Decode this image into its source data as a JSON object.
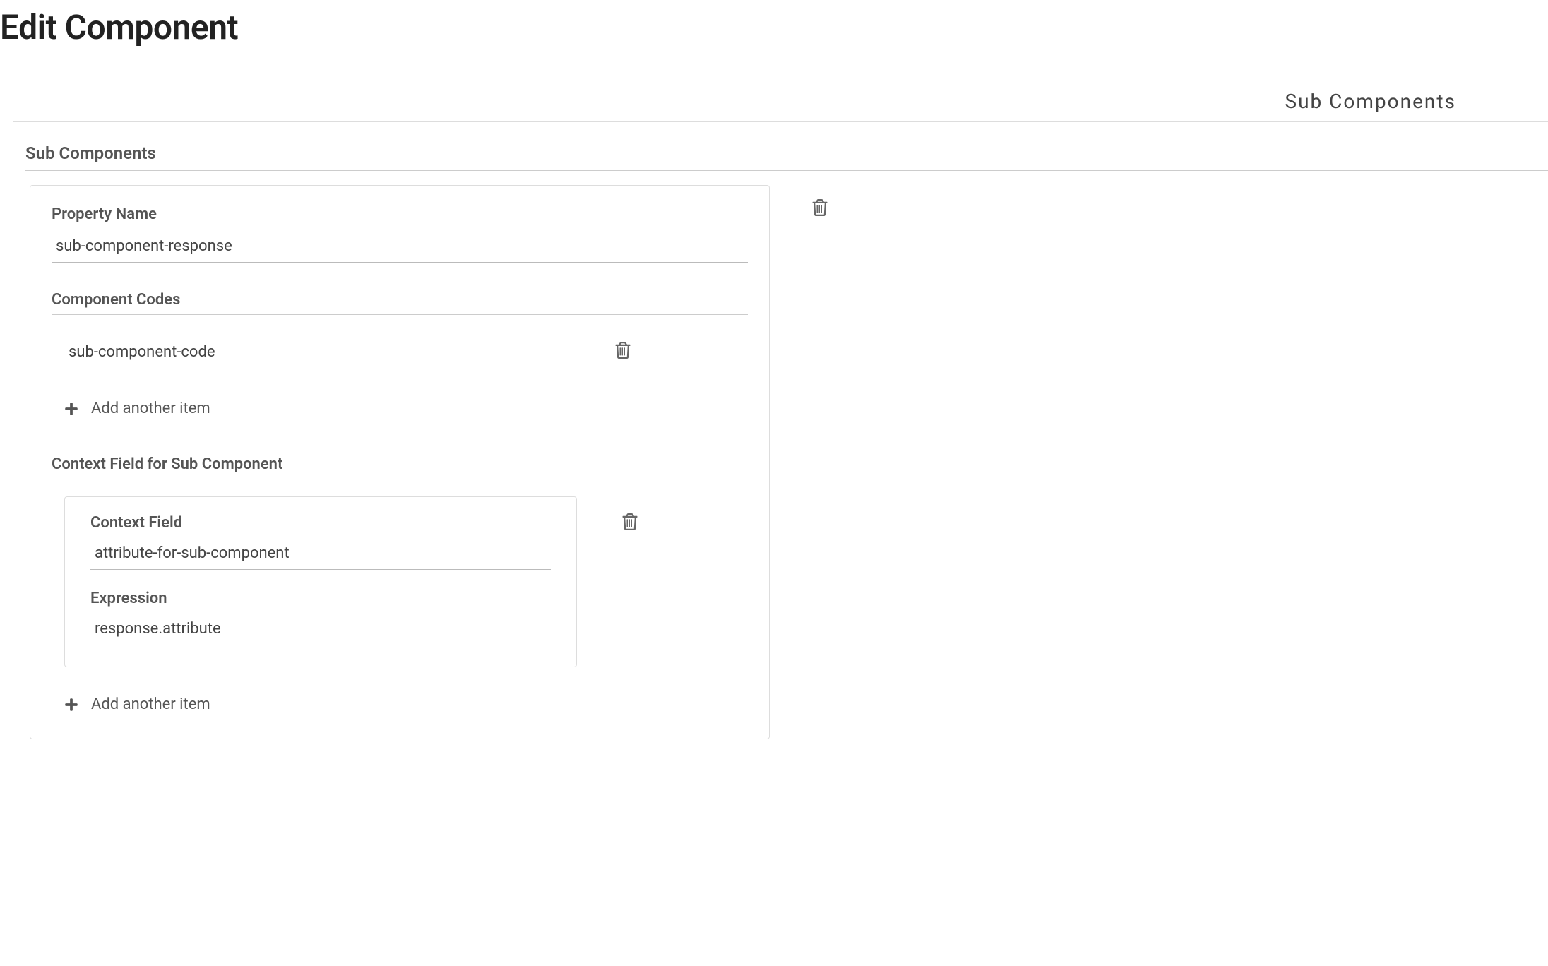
{
  "pageTitle": "Edit Component",
  "anchorLabel": "Sub Components",
  "sectionLabel": "Sub Components",
  "panel": {
    "propertyName": {
      "label": "Property Name",
      "value": "sub-component-response"
    },
    "componentCodes": {
      "label": "Component Codes",
      "items": [
        {
          "value": "sub-component-code"
        }
      ],
      "addLabel": "Add another item"
    },
    "contextSection": {
      "label": "Context Field for Sub Component",
      "entries": [
        {
          "contextFieldLabel": "Context Field",
          "contextFieldValue": "attribute-for-sub-component",
          "expressionLabel": "Expression",
          "expressionValue": "response.attribute"
        }
      ],
      "addLabel": "Add another item"
    }
  }
}
